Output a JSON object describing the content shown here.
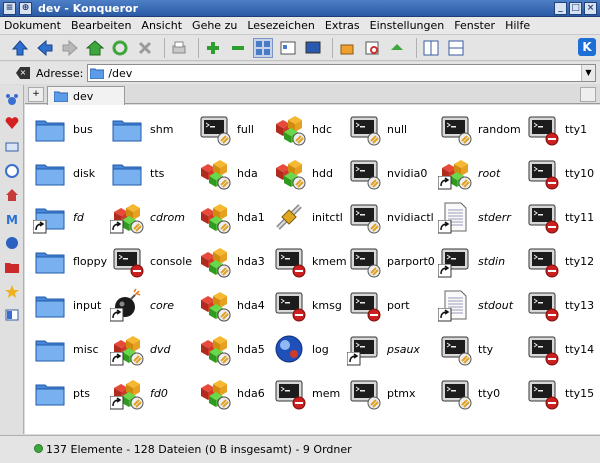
{
  "window": {
    "title": "dev - Konqueror"
  },
  "menu": [
    "Dokument",
    "Bearbeiten",
    "Ansicht",
    "Gehe zu",
    "Lesezeichen",
    "Extras",
    "Einstellungen",
    "Fenster",
    "Hilfe"
  ],
  "address": {
    "label": "Adresse:",
    "value": "/dev"
  },
  "tab": {
    "label": "dev"
  },
  "colors": {
    "folder": "#5b9be8",
    "terminal": "#2a2a2a",
    "forbidden": "#cc1f1f",
    "accent": "#2a5aa3"
  },
  "columns": [
    {
      "items": [
        {
          "name": "bus",
          "icon": "folder-icon",
          "italic": false
        },
        {
          "name": "disk",
          "icon": "folder-icon",
          "italic": false
        },
        {
          "name": "fd",
          "icon": "folder-link-icon",
          "italic": true
        },
        {
          "name": "floppy",
          "icon": "folder-icon",
          "italic": false
        },
        {
          "name": "input",
          "icon": "folder-icon",
          "italic": false
        },
        {
          "name": "misc",
          "icon": "folder-icon",
          "italic": false
        },
        {
          "name": "pts",
          "icon": "folder-icon",
          "italic": false
        }
      ]
    },
    {
      "items": [
        {
          "name": "shm",
          "icon": "folder-icon",
          "italic": false
        },
        {
          "name": "tts",
          "icon": "folder-icon",
          "italic": false
        },
        {
          "name": "cdrom",
          "icon": "blockdev-link-icon",
          "italic": true
        },
        {
          "name": "console",
          "icon": "terminal-forbidden-icon",
          "italic": false
        },
        {
          "name": "core",
          "icon": "bomb-link-icon",
          "italic": true
        },
        {
          "name": "dvd",
          "icon": "blockdev-link-icon",
          "italic": true
        },
        {
          "name": "fd0",
          "icon": "blockdev-link-icon",
          "italic": true
        }
      ]
    },
    {
      "items": [
        {
          "name": "full",
          "icon": "terminal-lock-icon",
          "italic": false
        },
        {
          "name": "hda",
          "icon": "blockdev-forbidden-icon",
          "italic": false
        },
        {
          "name": "hda1",
          "icon": "blockdev-forbidden-icon",
          "italic": false
        },
        {
          "name": "hda3",
          "icon": "blockdev-forbidden-icon",
          "italic": false
        },
        {
          "name": "hda4",
          "icon": "blockdev-forbidden-icon",
          "italic": false
        },
        {
          "name": "hda5",
          "icon": "blockdev-forbidden-icon",
          "italic": false
        },
        {
          "name": "hda6",
          "icon": "blockdev-forbidden-icon",
          "italic": false
        }
      ]
    },
    {
      "items": [
        {
          "name": "hdc",
          "icon": "blockdev-icon",
          "italic": false
        },
        {
          "name": "hdd",
          "icon": "blockdev-icon",
          "italic": false
        },
        {
          "name": "initctl",
          "icon": "pipe-icon",
          "italic": false
        },
        {
          "name": "kmem",
          "icon": "terminal-forbidden-icon",
          "italic": false
        },
        {
          "name": "kmsg",
          "icon": "terminal-forbidden-icon",
          "italic": false
        },
        {
          "name": "log",
          "icon": "socket-icon",
          "italic": false
        },
        {
          "name": "mem",
          "icon": "terminal-forbidden-icon",
          "italic": false
        }
      ]
    },
    {
      "items": [
        {
          "name": "null",
          "icon": "terminal-lock-icon",
          "italic": false
        },
        {
          "name": "nvidia0",
          "icon": "terminal-lock-icon",
          "italic": false
        },
        {
          "name": "nvidiactl",
          "icon": "terminal-lock-icon",
          "italic": false
        },
        {
          "name": "parport0",
          "icon": "terminal-lock-icon",
          "italic": false
        },
        {
          "name": "port",
          "icon": "terminal-forbidden-icon",
          "italic": false
        },
        {
          "name": "psaux",
          "icon": "terminal-link-icon",
          "italic": true
        },
        {
          "name": "ptmx",
          "icon": "terminal-lock-icon",
          "italic": false
        }
      ]
    },
    {
      "items": [
        {
          "name": "random",
          "icon": "terminal-lock-icon",
          "italic": false
        },
        {
          "name": "root",
          "icon": "blockdev-link-icon",
          "italic": true
        },
        {
          "name": "stderr",
          "icon": "text-link-icon",
          "italic": true
        },
        {
          "name": "stdin",
          "icon": "terminal-link-icon",
          "italic": true
        },
        {
          "name": "stdout",
          "icon": "text-link-icon",
          "italic": true
        },
        {
          "name": "tty",
          "icon": "terminal-lock-icon",
          "italic": false
        },
        {
          "name": "tty0",
          "icon": "terminal-lock-icon",
          "italic": false
        }
      ]
    },
    {
      "items": [
        {
          "name": "tty1",
          "icon": "terminal-forbidden-icon",
          "italic": false
        },
        {
          "name": "tty10",
          "icon": "terminal-forbidden-icon",
          "italic": false
        },
        {
          "name": "tty11",
          "icon": "terminal-forbidden-icon",
          "italic": false
        },
        {
          "name": "tty12",
          "icon": "terminal-forbidden-icon",
          "italic": false
        },
        {
          "name": "tty13",
          "icon": "terminal-forbidden-icon",
          "italic": false
        },
        {
          "name": "tty14",
          "icon": "terminal-forbidden-icon",
          "italic": false
        },
        {
          "name": "tty15",
          "icon": "terminal-forbidden-icon",
          "italic": false
        }
      ]
    }
  ],
  "status": {
    "text": "137 Elemente - 128 Dateien (0 B insgesamt) - 9 Ordner"
  }
}
